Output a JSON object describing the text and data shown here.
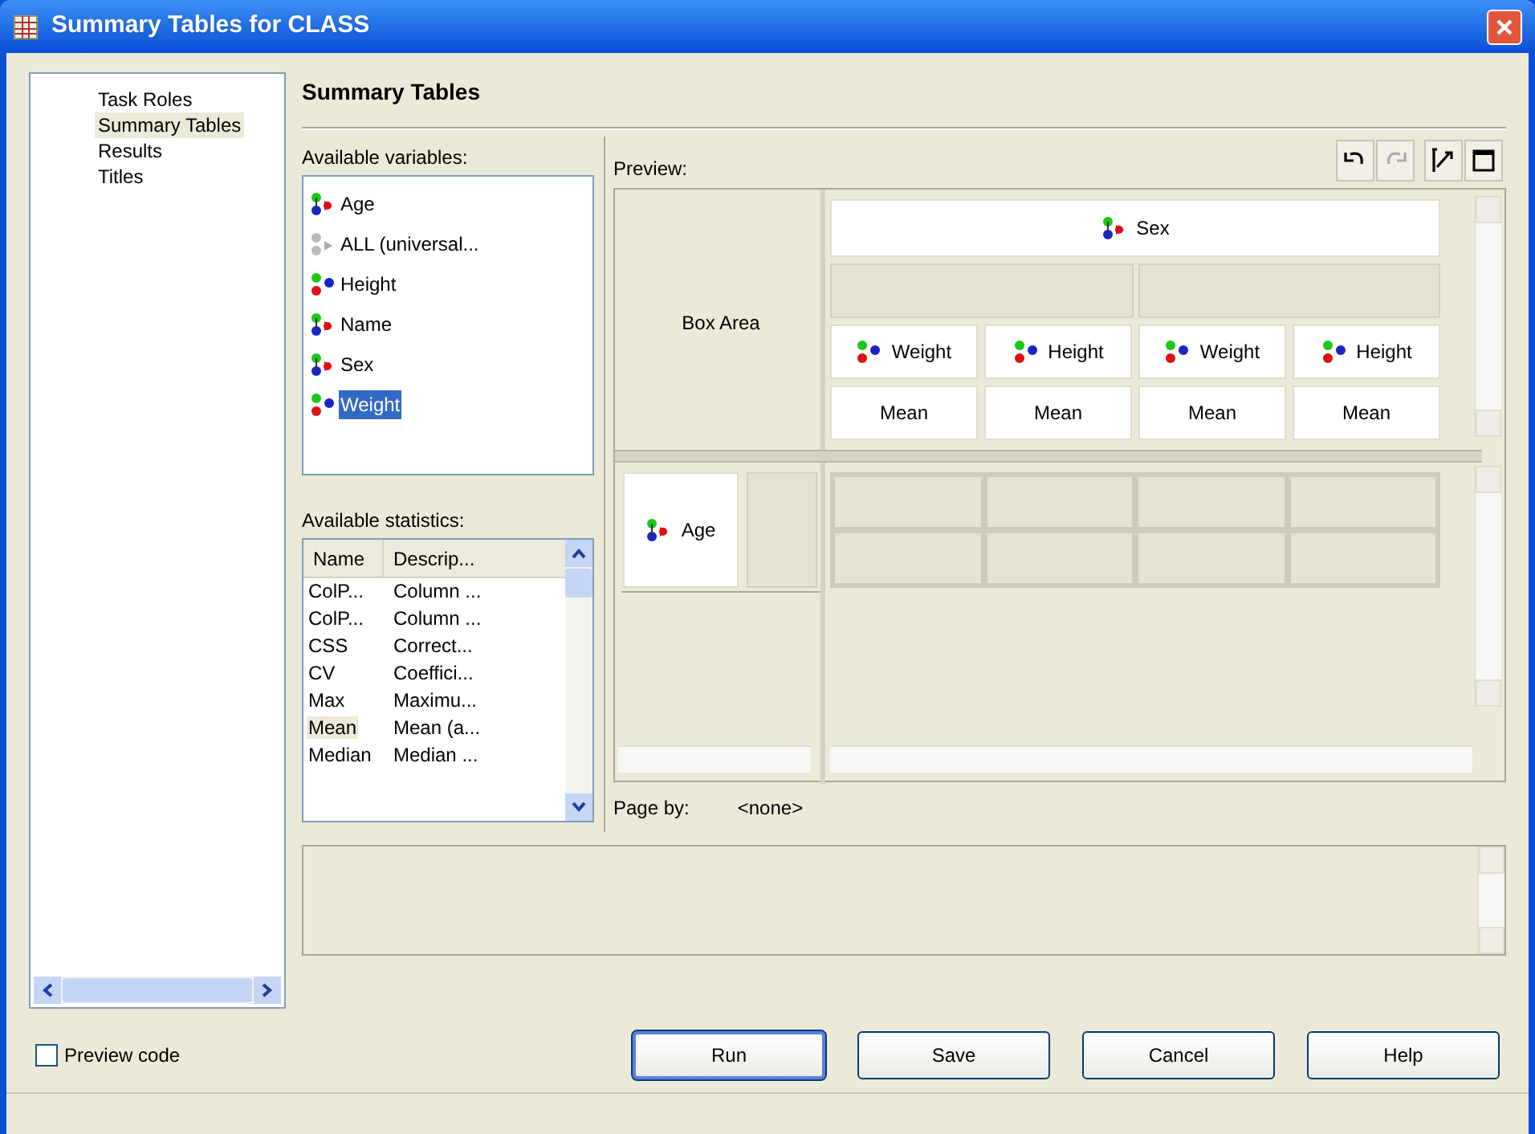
{
  "window": {
    "title": "Summary Tables for CLASS"
  },
  "nav": {
    "items": [
      {
        "label": "Task Roles",
        "selected": false
      },
      {
        "label": "Summary Tables",
        "selected": true
      },
      {
        "label": "Results",
        "selected": false
      },
      {
        "label": "Titles",
        "selected": false
      }
    ]
  },
  "heading": "Summary Tables",
  "variables": {
    "label": "Available variables:",
    "items": [
      {
        "name": "Age",
        "kind": "character",
        "selected": false
      },
      {
        "name": "ALL (universal...",
        "kind": "universal",
        "selected": false
      },
      {
        "name": "Height",
        "kind": "numeric",
        "selected": false
      },
      {
        "name": "Name",
        "kind": "character",
        "selected": false
      },
      {
        "name": "Sex",
        "kind": "character",
        "selected": false
      },
      {
        "name": "Weight",
        "kind": "numeric",
        "selected": true
      }
    ]
  },
  "statistics": {
    "label": "Available statistics:",
    "columns": [
      "Name",
      "Descrip..."
    ],
    "rows": [
      {
        "name": "ColP...",
        "description": "Column ...",
        "selected": false
      },
      {
        "name": "ColP...",
        "description": "Column ...",
        "selected": false
      },
      {
        "name": "CSS",
        "description": "Correct...",
        "selected": false
      },
      {
        "name": "CV",
        "description": "Coeffici...",
        "selected": false
      },
      {
        "name": "Max",
        "description": "Maximu...",
        "selected": false
      },
      {
        "name": "Mean",
        "description": "Mean (a...",
        "selected": true
      },
      {
        "name": "Median",
        "description": "Median ...",
        "selected": false
      }
    ]
  },
  "preview": {
    "label": "Preview:",
    "toolbar": [
      {
        "kind": "undo",
        "disabled": false
      },
      {
        "kind": "redo",
        "disabled": true
      },
      {
        "kind": "swap",
        "disabled": false
      },
      {
        "kind": "maximize",
        "disabled": false
      }
    ],
    "box_area": "Box Area",
    "column_variable": {
      "name": "Sex",
      "kind": "character"
    },
    "analysis": [
      {
        "name": "Weight",
        "kind": "numeric",
        "statistic": "Mean"
      },
      {
        "name": "Height",
        "kind": "numeric",
        "statistic": "Mean"
      },
      {
        "name": "Weight",
        "kind": "numeric",
        "statistic": "Mean"
      },
      {
        "name": "Height",
        "kind": "numeric",
        "statistic": "Mean"
      }
    ],
    "row_variable": {
      "name": "Age",
      "kind": "character"
    }
  },
  "page_by": {
    "label": "Page by:",
    "value": "<none>"
  },
  "preview_code": {
    "label": "Preview code",
    "checked": false
  },
  "buttons": [
    {
      "label": "Run",
      "default": true
    },
    {
      "label": "Save",
      "default": false
    },
    {
      "label": "Cancel",
      "default": false
    },
    {
      "label": "Help",
      "default": false
    }
  ]
}
